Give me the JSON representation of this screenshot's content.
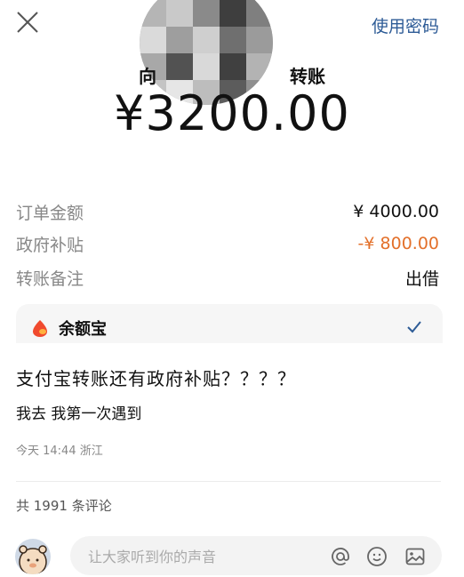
{
  "header": {
    "close_icon": "close-icon",
    "use_password_label": "使用密码",
    "recipient_prefix": "向",
    "recipient_suffix": "转账"
  },
  "payment": {
    "amount": "¥3200.00"
  },
  "details": [
    {
      "label": "订单金额",
      "value": "¥ 4000.00"
    },
    {
      "label": "政府补贴",
      "value": "-¥ 800.00"
    },
    {
      "label": "转账备注",
      "value": "出借"
    }
  ],
  "pay_method": {
    "icon": "yuebao-icon",
    "label": "余额宝",
    "selected_icon": "checkmark-icon"
  },
  "post": {
    "title": "支付宝转账还有政府补贴？？？？",
    "body": "我去 我第一次遇到",
    "time": "今天 14:44",
    "location": "浙江"
  },
  "comments": {
    "count_text": "共 1991 条评论"
  },
  "comment_input": {
    "placeholder": "让大家听到你的声音",
    "icons": [
      "at-icon",
      "emoji-icon",
      "image-icon"
    ]
  },
  "colors": {
    "link": "#2d5b96",
    "discount": "#e3702a",
    "muted": "#888888"
  }
}
